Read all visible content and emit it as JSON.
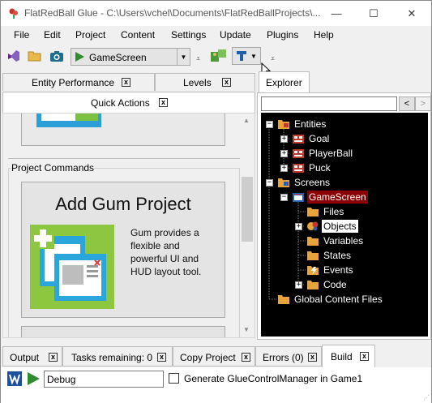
{
  "window": {
    "title": "FlatRedBall Glue - C:\\Users\\vchel\\Documents\\FlatRedBallProjects\\...",
    "minimize_glyph": "—",
    "maximize_glyph": "☐",
    "close_glyph": "✕"
  },
  "menu": [
    "File",
    "Edit",
    "Project",
    "Content",
    "Settings",
    "Update",
    "Plugins",
    "Help"
  ],
  "toolbar": {
    "screen_selector_value": "GameScreen",
    "split_glyph": "⩡"
  },
  "left_tabs": [
    {
      "label": "Entity Performance",
      "close": "x"
    },
    {
      "label": "Levels",
      "close": "x"
    }
  ],
  "quick_actions_tab": {
    "label": "Quick Actions",
    "close": "x"
  },
  "project_commands": {
    "group_label": "Project Commands",
    "gum_card": {
      "title": "Add Gum Project",
      "description": "Gum provides a flexible and powerful UI and HUD layout tool."
    }
  },
  "explorer": {
    "tab_label": "Explorer",
    "search_placeholder": "",
    "back_glyph": "<",
    "forward_glyph": ">",
    "tree": [
      {
        "label": "Entities",
        "depth": 0,
        "expander": "−",
        "icon": "folder-icon"
      },
      {
        "label": "Goal",
        "depth": 1,
        "expander": "+",
        "icon": "entity-icon"
      },
      {
        "label": "PlayerBall",
        "depth": 1,
        "expander": "+",
        "icon": "entity-icon"
      },
      {
        "label": "Puck",
        "depth": 1,
        "expander": "+",
        "icon": "entity-icon"
      },
      {
        "label": "Screens",
        "depth": 0,
        "expander": "−",
        "icon": "folder-icon"
      },
      {
        "label": "GameScreen",
        "depth": 1,
        "expander": "−",
        "icon": "screen-icon",
        "state": "selected-red"
      },
      {
        "label": "Files",
        "depth": 2,
        "expander": "",
        "icon": "folder-icon"
      },
      {
        "label": "Objects",
        "depth": 2,
        "expander": "+",
        "icon": "objects-icon",
        "state": "selected-white"
      },
      {
        "label": "Variables",
        "depth": 2,
        "expander": "",
        "icon": "folder-icon"
      },
      {
        "label": "States",
        "depth": 2,
        "expander": "",
        "icon": "folder-icon"
      },
      {
        "label": "Events",
        "depth": 2,
        "expander": "",
        "icon": "events-icon"
      },
      {
        "label": "Code",
        "depth": 2,
        "expander": "+",
        "icon": "folder-icon"
      },
      {
        "label": "Global Content Files",
        "depth": 0,
        "expander": "",
        "icon": "folder-icon"
      }
    ]
  },
  "bottom_tabs": [
    {
      "label": "Output",
      "close": "x",
      "active": false
    },
    {
      "label": "Tasks remaining: 0",
      "close": "x",
      "active": false
    },
    {
      "label": "Copy Project",
      "close": "x",
      "active": false
    },
    {
      "label": "Errors (0)",
      "close": "x",
      "active": false
    },
    {
      "label": "Build",
      "close": "x",
      "active": true
    }
  ],
  "build": {
    "configuration_value": "Debug",
    "generate_checkbox_checked": false,
    "generate_label": "Generate GlueControlManager in Game1"
  },
  "colors": {
    "tree_background": "#000000",
    "selection_red": "#8b0000",
    "play_green": "#2e8b2e",
    "folder_orange": "#e8a33a"
  }
}
